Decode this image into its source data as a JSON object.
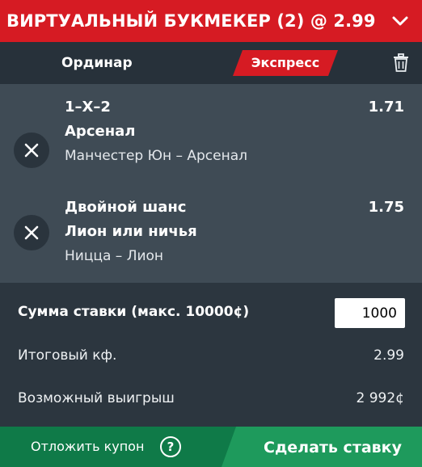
{
  "header": {
    "title": "ВИРТУАЛЬНЫЙ БУКМЕКЕР (2) @ 2.99",
    "chevron_icon": "chevron-down-icon"
  },
  "tabs": {
    "single": "Ординар",
    "express": "Экспресс",
    "active": "express",
    "trash_icon": "trash-icon"
  },
  "bets": [
    {
      "market": "1–X–2",
      "pick": "Арсенал",
      "match": "Манчестер Юн – Арсенал",
      "odds": "1.71",
      "remove_icon": "close-icon"
    },
    {
      "market": "Двойной шанс",
      "pick": "Лион или ничья",
      "match": "Ницца – Лион",
      "odds": "1.75",
      "remove_icon": "close-icon"
    }
  ],
  "summary": {
    "stake_label": "Сумма ставки (макс. 10000¢)",
    "stake_value": "1000",
    "total_odds_label": "Итоговый кф.",
    "total_odds_value": "2.99",
    "payout_label": "Возможный выигрыш",
    "payout_value": "2 992¢"
  },
  "footer": {
    "postpone_label": "Отложить купон",
    "help_label": "?",
    "place_bet_label": "Сделать ставку"
  },
  "colors": {
    "header_red": "#d61b23",
    "tab_bar": "#27313a",
    "bets_bg": "#3f4b55",
    "summary_bg": "#2c363f",
    "footer_green": "#0f7a48",
    "footer_green_light": "#1e9a5c"
  }
}
